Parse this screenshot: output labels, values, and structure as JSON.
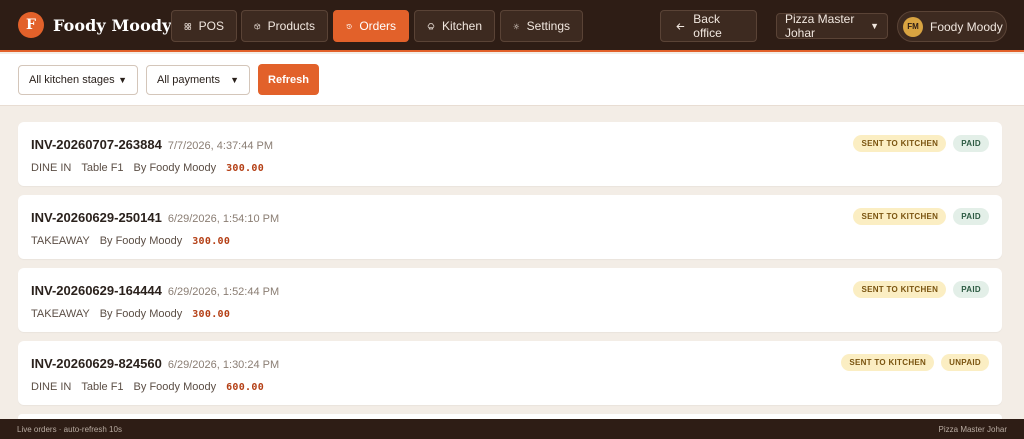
{
  "brand": {
    "logo_letter": "F",
    "name": "Foody Moody"
  },
  "nav": {
    "items": [
      {
        "label": "POS",
        "icon": "grid-icon"
      },
      {
        "label": "Products",
        "icon": "box-icon"
      },
      {
        "label": "Orders",
        "icon": "history-icon",
        "active": true
      },
      {
        "label": "Kitchen",
        "icon": "chef-hat-icon"
      },
      {
        "label": "Settings",
        "icon": "gear-icon"
      }
    ],
    "back_office": "Back office",
    "branch": "Pizza Master Johar",
    "user": {
      "initials": "FM",
      "name": "Foody Moody"
    }
  },
  "filters": {
    "kitchen_stage": "All kitchen stages",
    "payment": "All payments",
    "refresh_label": "Refresh"
  },
  "orders": [
    {
      "invoice": "INV-20260707-263884",
      "datetime": "7/7/2026, 4:37:44 PM",
      "type": "DINE IN",
      "table": "Table F1",
      "by": "By Foody Moody",
      "amount": "300.00",
      "kitchen_status": "SENT TO KITCHEN",
      "payment_status": "PAID"
    },
    {
      "invoice": "INV-20260629-250141",
      "datetime": "6/29/2026, 1:54:10 PM",
      "type": "TAKEAWAY",
      "table": "",
      "by": "By Foody Moody",
      "amount": "300.00",
      "kitchen_status": "SENT TO KITCHEN",
      "payment_status": "PAID"
    },
    {
      "invoice": "INV-20260629-164444",
      "datetime": "6/29/2026, 1:52:44 PM",
      "type": "TAKEAWAY",
      "table": "",
      "by": "By Foody Moody",
      "amount": "300.00",
      "kitchen_status": "SENT TO KITCHEN",
      "payment_status": "PAID"
    },
    {
      "invoice": "INV-20260629-824560",
      "datetime": "6/29/2026, 1:30:24 PM",
      "type": "DINE IN",
      "table": "Table F1",
      "by": "By Foody Moody",
      "amount": "600.00",
      "kitchen_status": "SENT TO KITCHEN",
      "payment_status": "UNPAID"
    }
  ],
  "footer": {
    "left": "Live orders · auto-refresh 10s",
    "right": "Pizza Master Johar"
  },
  "colors": {
    "accent": "#e2612a",
    "nav_bg": "#2e1d15",
    "page_bg": "#f3ede6",
    "amount": "#b43f15"
  }
}
